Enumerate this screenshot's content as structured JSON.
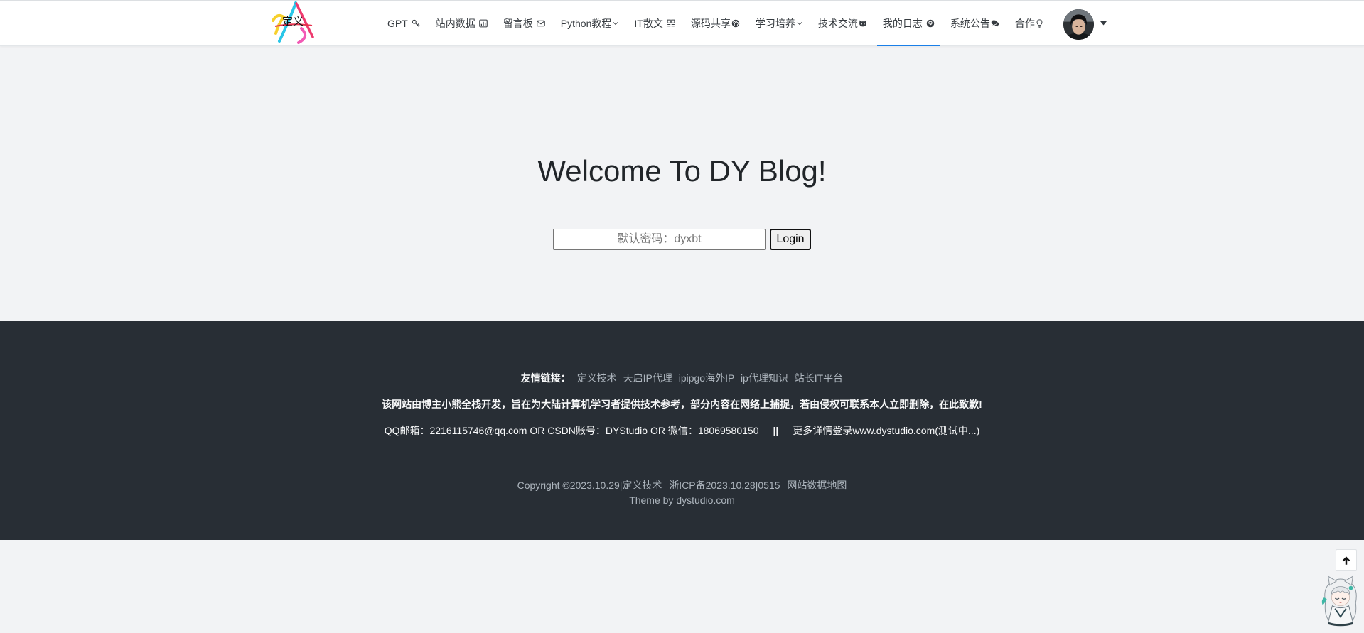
{
  "brand": {
    "logo_text": "定义",
    "logo_icon": "site-logo"
  },
  "nav": {
    "items": [
      {
        "label": "GPT",
        "icon": "key-icon"
      },
      {
        "label": "站内数据",
        "icon": "bar-chart-icon"
      },
      {
        "label": "留言板",
        "icon": "envelope-icon"
      },
      {
        "label": "Python教程",
        "icon": "chevron-down-icon"
      },
      {
        "label": "IT散文",
        "icon": "grid-icon"
      },
      {
        "label": "源码共享",
        "icon": "globe-icon"
      },
      {
        "label": "学习培养",
        "icon": "chevron-down-icon"
      },
      {
        "label": "技术交流",
        "icon": "github-icon"
      },
      {
        "label": "我的日志",
        "icon": "pinterest-icon",
        "active": true
      },
      {
        "label": "系统公告",
        "icon": "comments-icon"
      },
      {
        "label": "合作",
        "icon": "lightbulb-icon"
      }
    ]
  },
  "user": {
    "avatar_icon": "user-avatar",
    "menu_icon": "caret-down-icon"
  },
  "hero": {
    "title": "Welcome To DY Blog!",
    "password_placeholder": "默认密码：dyxbt",
    "login_label": "Login"
  },
  "footer": {
    "friend_links_label": "友情链接：",
    "friend_links": [
      "定义技术",
      "天启IP代理",
      "ipipgo海外IP",
      "ip代理知识",
      "站长IT平台"
    ],
    "notice": "该网站由博主小熊全栈开发，旨在为大陆计算机学习者提供技术参考，部分内容在网络上捕捉，若由侵权可联系本人立即删除，在此致歉!",
    "contact": "QQ邮箱：2216115746@qq.com OR CSDN账号：DYStudio OR 微信：18069580150",
    "separator": "||",
    "more": "更多详情登录www.dystudio.com(测试中...)",
    "copyright": "Copyright ©2023.10.29|定义技术",
    "icp": "浙ICP备2023.10.28|0515",
    "sitemap": "网站数据地图",
    "theme": "Theme by dystudio.com"
  },
  "widgets": {
    "back_to_top_icon": "arrow-up-icon",
    "mascot_icon": "mascot-character-icon"
  },
  "colors": {
    "accent": "#1a7fe8",
    "page_bg": "#f2f3f5",
    "footer_bg": "#282e35",
    "footer_text": "#f8f9fa",
    "footer_muted": "#adb5bd"
  }
}
